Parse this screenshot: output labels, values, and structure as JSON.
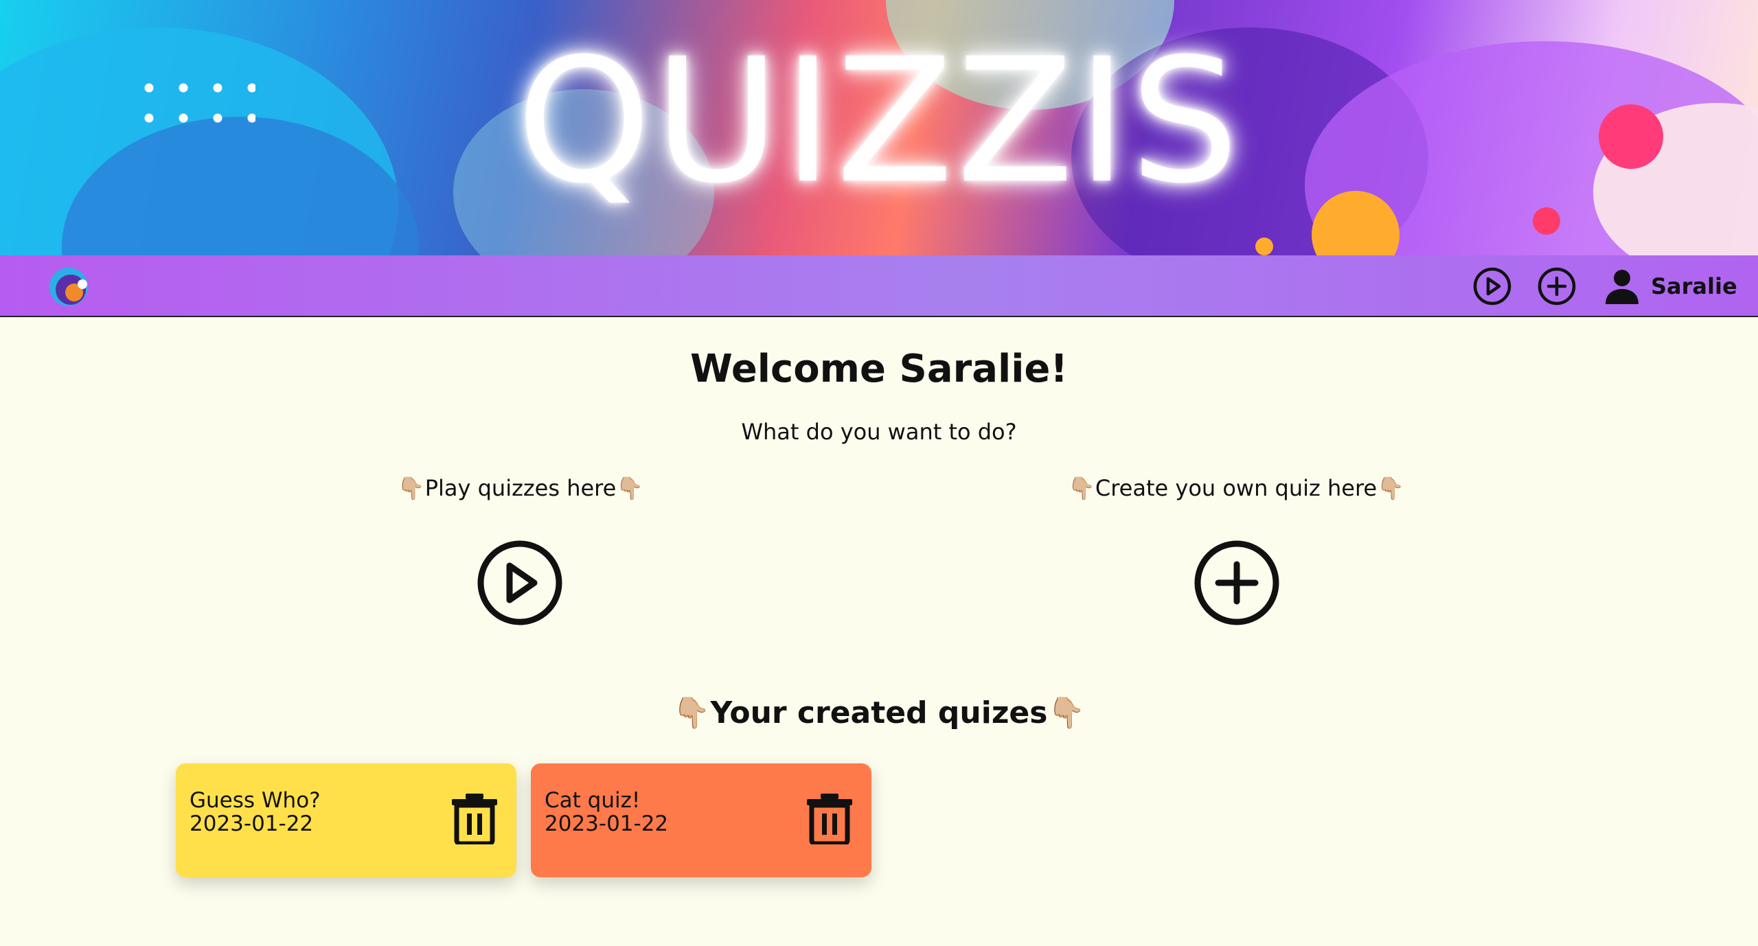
{
  "banner": {
    "title": "QUIZZIS"
  },
  "navbar": {
    "username": "Saralie"
  },
  "main": {
    "welcome": "Welcome Saralie!",
    "question": "What do you want to do?",
    "play_label": "👇🏼Play quizzes here👇🏼",
    "create_label": "👇🏼Create you own quiz here👇🏼",
    "created_title": "👇🏼Your created quizes👇🏼",
    "quizzes": [
      {
        "name": "Guess Who?",
        "date": "2023-01-22",
        "color": "#ffe04a"
      },
      {
        "name": "Cat quiz!",
        "date": "2023-01-22",
        "color": "#ff7a4a"
      }
    ]
  },
  "icons": {
    "logo": "app-logo-icon",
    "play": "play-circle-icon",
    "add": "plus-circle-icon",
    "user": "user-icon",
    "delete": "trash-icon"
  },
  "colors": {
    "background": "#fdfdee",
    "navbar": "#b75cf0",
    "card_yellow": "#ffe04a",
    "card_orange": "#ff7a4a"
  }
}
